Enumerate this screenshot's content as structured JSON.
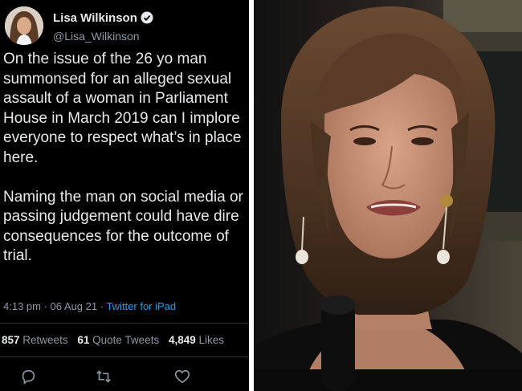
{
  "tweet": {
    "author_name": "Lisa Wilkinson",
    "handle": "@Lisa_Wilkinson",
    "lines_p1": [
      "On the issue of the 26 yo man",
      "summonsed for an alleged sexual",
      "assault of a woman in Parliament",
      "House in March 2019 can I implore",
      "everyone to respect what’s in place",
      "here."
    ],
    "lines_p2": [
      "Naming the man on social media or",
      "passing judgement could have dire",
      "consequences for the outcome of",
      "trial."
    ],
    "time": "4:13 pm",
    "date": "06 Aug 21",
    "source": "Twitter for iPad",
    "retweets": {
      "count": "857",
      "label": "Retweets"
    },
    "quotes": {
      "count": "61",
      "label": "Quote Tweets"
    },
    "likes": {
      "count": "4,849",
      "label": "Likes"
    },
    "actions": [
      "reply-icon",
      "retweet-icon",
      "like-icon"
    ]
  },
  "colors": {
    "background": "#000000",
    "text": "#e7e9ea",
    "muted": "#8b98a5",
    "link": "#1d9bf0"
  }
}
